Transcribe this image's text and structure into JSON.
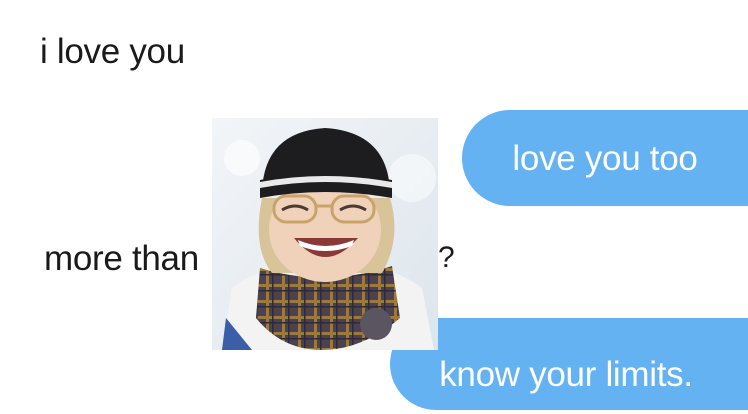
{
  "messages": {
    "first": "i love you",
    "second_prefix": "more than",
    "second_suffix": "?"
  },
  "replies": {
    "first": "love you too",
    "second": "know your limits."
  },
  "colors": {
    "bubble": "#64b2f1",
    "bubble_text": "#ffffff",
    "text": "#1a1a1a",
    "background": "#ffffff"
  },
  "photo": {
    "subject": "smiling person in black beanie and plaid scarf in snow"
  }
}
